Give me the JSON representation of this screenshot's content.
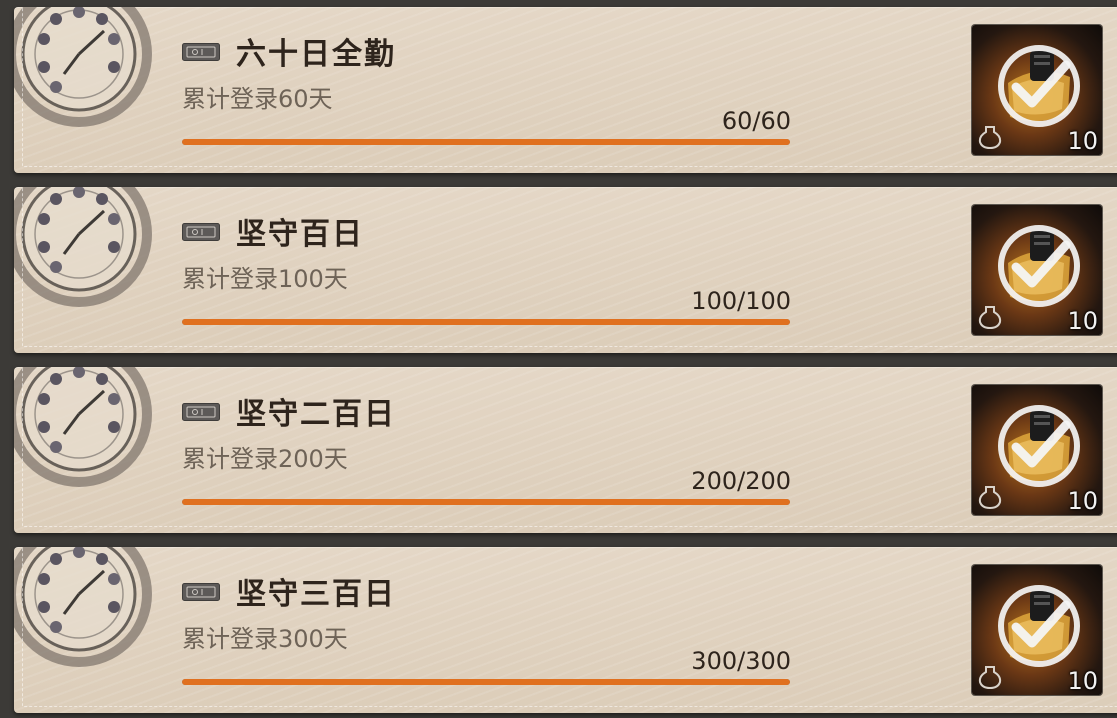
{
  "achievements": [
    {
      "title": "六十日全勤",
      "desc": "累计登录60天",
      "progress_text": "60/60",
      "progress": 1.0,
      "reward_count": "10",
      "status": "claimed"
    },
    {
      "title": "坚守百日",
      "desc": "累计登录100天",
      "progress_text": "100/100",
      "progress": 1.0,
      "reward_count": "10",
      "status": "claimed"
    },
    {
      "title": "坚守二百日",
      "desc": "累计登录200天",
      "progress_text": "200/200",
      "progress": 1.0,
      "reward_count": "10",
      "status": "claimed"
    },
    {
      "title": "坚守三百日",
      "desc": "累计登录300天",
      "progress_text": "300/300",
      "progress": 1.0,
      "reward_count": "10",
      "status": "claimed"
    }
  ],
  "icons": {
    "card_emblem": "clock-icon",
    "title_badge": "ticket-icon",
    "reward_item": "scroll-item-icon",
    "claimed_mark": "check-icon",
    "reward_type": "ink-bottle-icon"
  },
  "colors": {
    "progress_fill": "#e0701f",
    "card_bg": "#e0d2bf",
    "title_text": "#2e241c",
    "desc_text": "#6e6357"
  }
}
